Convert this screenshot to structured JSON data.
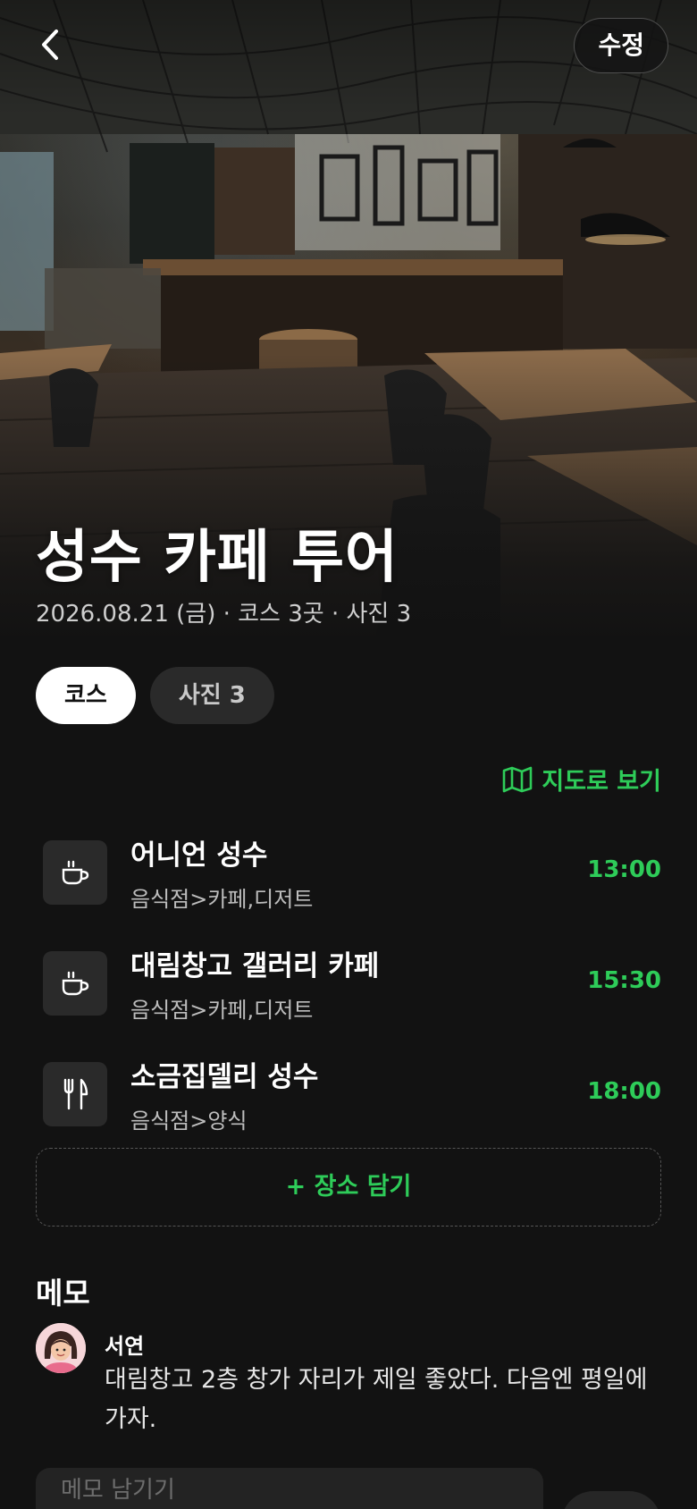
{
  "header": {
    "back_icon": "chevron-left-icon",
    "edit_label": "수정"
  },
  "hero": {
    "title": "성수 카페 투어",
    "meta": "2026.08.21 (금) · 코스 3곳 · 사진 3"
  },
  "tabs": [
    {
      "label": "코스",
      "active": true
    },
    {
      "label": "사진 3",
      "active": false
    }
  ],
  "map_link": {
    "label": "지도로 보기",
    "icon": "map-icon"
  },
  "course": [
    {
      "name": "어니언 성수",
      "category": "음식점>카페,디저트",
      "time": "13:00",
      "icon": "coffee-cup-icon"
    },
    {
      "name": "대림창고 갤러리 카페",
      "category": "음식점>카페,디저트",
      "time": "15:30",
      "icon": "coffee-cup-icon"
    },
    {
      "name": "소금집델리 성수",
      "category": "음식점>양식",
      "time": "18:00",
      "icon": "fork-knife-icon"
    }
  ],
  "add_place_label": "+ 장소 담기",
  "memo": {
    "heading": "메모",
    "items": [
      {
        "author": "서연",
        "text": "대림창고 2층 창가 자리가 제일 좋았다. 다음엔 평일에 가자."
      }
    ],
    "input_placeholder": "메모 남기기"
  },
  "colors": {
    "accent": "#2ecc59",
    "background": "#121212",
    "surface": "#2a2a2a"
  }
}
